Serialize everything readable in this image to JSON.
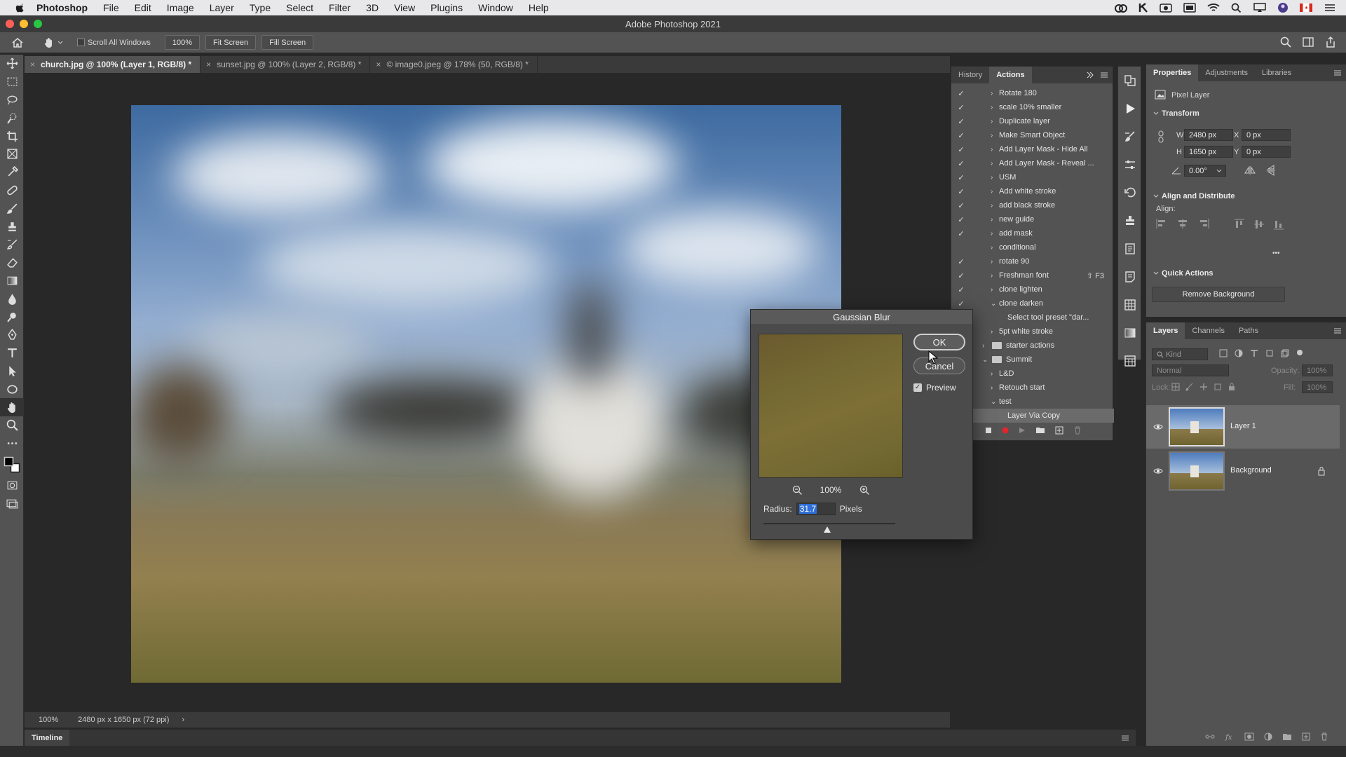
{
  "menubar": {
    "app": "Photoshop",
    "items": [
      "File",
      "Edit",
      "Image",
      "Layer",
      "Type",
      "Select",
      "Filter",
      "3D",
      "View",
      "Plugins",
      "Window",
      "Help"
    ]
  },
  "window": {
    "title": "Adobe Photoshop 2021"
  },
  "options": {
    "scroll_all": "Scroll All Windows",
    "zoom_btn": "100%",
    "fit_screen": "Fit Screen",
    "fill_screen": "Fill Screen"
  },
  "doc_tabs": [
    {
      "label": "church.jpg @ 100% (Layer 1, RGB/8) *",
      "active": true
    },
    {
      "label": "sunset.jpg @ 100% (Layer 2, RGB/8) *",
      "active": false
    },
    {
      "label": "© image0.jpeg @ 178% (50, RGB/8) *",
      "active": false
    }
  ],
  "status": {
    "zoom": "100%",
    "doc_info": "2480 px x 1650 px (72 ppi)",
    "arrow": "›"
  },
  "timeline": {
    "label": "Timeline"
  },
  "actions_panel": {
    "tabs": [
      "History",
      "Actions"
    ],
    "active_tab": "Actions",
    "rows": [
      {
        "label": "Rotate 180",
        "checked": true,
        "type": "action"
      },
      {
        "label": "scale 10% smaller",
        "checked": true,
        "type": "action"
      },
      {
        "label": "Duplicate layer",
        "checked": true,
        "type": "action"
      },
      {
        "label": "Make Smart Object",
        "checked": true,
        "type": "action"
      },
      {
        "label": "Add Layer Mask - Hide All",
        "checked": true,
        "type": "action"
      },
      {
        "label": "Add Layer Mask - Reveal ...",
        "checked": true,
        "type": "action"
      },
      {
        "label": "USM",
        "checked": true,
        "type": "action"
      },
      {
        "label": "Add white stroke",
        "checked": true,
        "type": "action"
      },
      {
        "label": "add black stroke",
        "checked": true,
        "type": "action"
      },
      {
        "label": "new guide",
        "checked": true,
        "type": "action"
      },
      {
        "label": "add mask",
        "checked": true,
        "type": "action"
      },
      {
        "label": "conditional",
        "checked": false,
        "type": "action"
      },
      {
        "label": "rotate 90",
        "checked": true,
        "type": "action"
      },
      {
        "label": "Freshman font",
        "checked": true,
        "type": "action",
        "shortcut": "⇧ F3"
      },
      {
        "label": "clone lighten",
        "checked": true,
        "type": "action"
      },
      {
        "label": "clone darken",
        "checked": true,
        "type": "action-open"
      },
      {
        "label": "Select tool preset \"dar...",
        "checked": false,
        "type": "step"
      },
      {
        "label": "5pt white stroke",
        "checked": false,
        "type": "action"
      },
      {
        "label": "starter actions",
        "checked": false,
        "type": "set"
      },
      {
        "label": "Summit",
        "checked": false,
        "type": "set-open"
      },
      {
        "label": "L&D",
        "checked": false,
        "type": "action"
      },
      {
        "label": "Retouch start",
        "checked": false,
        "type": "action"
      },
      {
        "label": "test",
        "checked": false,
        "type": "action-open"
      },
      {
        "label": "Layer Via Copy",
        "checked": false,
        "type": "step",
        "selected": true
      }
    ]
  },
  "properties": {
    "tabs": [
      "Properties",
      "Adjustments",
      "Libraries"
    ],
    "active_tab": "Properties",
    "kind": "Pixel Layer",
    "transform_title": "Transform",
    "w_label": "W",
    "w_value": "2480 px",
    "x_label": "X",
    "x_value": "0 px",
    "h_label": "H",
    "h_value": "1650 px",
    "y_label": "Y",
    "y_value": "0 px",
    "angle_value": "0.00°",
    "align_title": "Align and Distribute",
    "align_label": "Align:",
    "more": "•••",
    "quick_title": "Quick Actions",
    "remove_bg": "Remove Background"
  },
  "layers_panel": {
    "tabs": [
      "Layers",
      "Channels",
      "Paths"
    ],
    "active_tab": "Layers",
    "kind_placeholder": "Kind",
    "blend_mode": "Normal",
    "opacity_label": "Opacity:",
    "opacity_value": "100%",
    "lock_label": "Lock:",
    "fill_label": "Fill:",
    "fill_value": "100%",
    "layers": [
      {
        "name": "Layer 1",
        "selected": true
      },
      {
        "name": "Background",
        "selected": false
      }
    ]
  },
  "dialog": {
    "title": "Gaussian Blur",
    "ok": "OK",
    "cancel": "Cancel",
    "preview_label": "Preview",
    "zoom_value": "100%",
    "radius_label": "Radius:",
    "radius_value": "31.7",
    "radius_unit": "Pixels"
  }
}
